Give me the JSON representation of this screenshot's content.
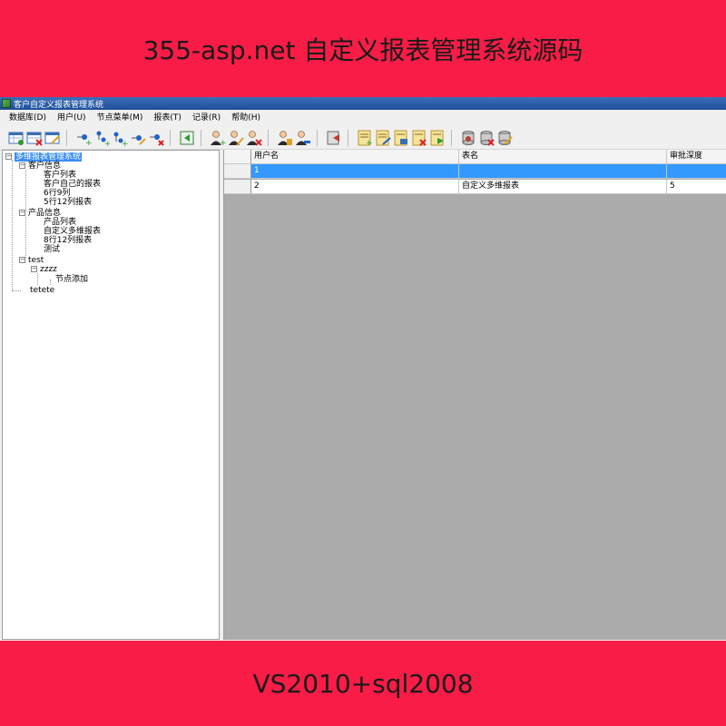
{
  "banner_top": "355-asp.net 自定义报表管理系统源码",
  "banner_bottom": "VS2010+sql2008",
  "window": {
    "title": "客户自定义报表管理系统"
  },
  "menu": [
    "数据库(D)",
    "用户(U)",
    "节点菜单(M)",
    "报表(T)",
    "记录(R)",
    "帮助(H)"
  ],
  "tree": {
    "root": "多维报表管理系统",
    "groups": [
      {
        "label": "客户信息",
        "children": [
          "客户列表",
          "客户自己的报表",
          "6行9列",
          "5行12列报表"
        ]
      },
      {
        "label": "产品信息",
        "children": [
          "产品列表",
          "自定义多维报表",
          "8行12列报表",
          "测试"
        ]
      },
      {
        "label": "test",
        "subgroup": {
          "label": "zzzz",
          "children": [
            "节点添加"
          ]
        }
      },
      {
        "label": "tetete"
      }
    ]
  },
  "grid": {
    "columns": [
      "用户名",
      "表名",
      "审批深度"
    ],
    "rows": [
      [
        "1",
        "",
        ""
      ],
      [
        "2",
        "自定义多维报表",
        "5"
      ]
    ],
    "selected_row": 1
  },
  "colors": {
    "banner": "#f81c46",
    "selection": "#3399ff",
    "grid_bg": "#ababab"
  }
}
